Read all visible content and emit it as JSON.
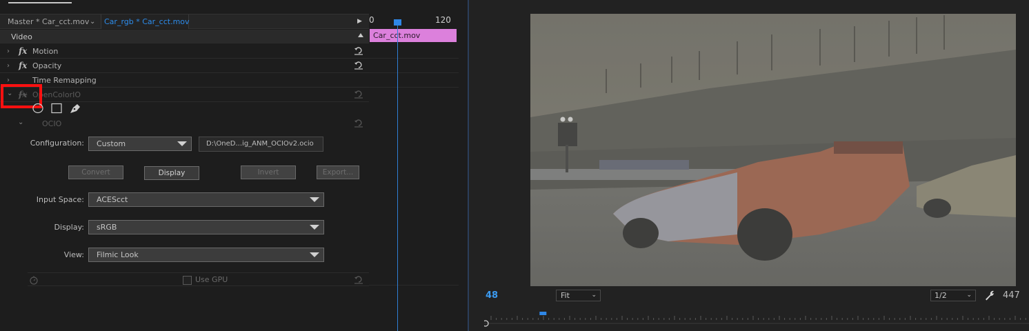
{
  "effect_controls": {
    "tabs": {
      "master": "Master * Car_cct.mov",
      "active": "Car_rgb * Car_cct.mov"
    },
    "section": "Video",
    "effects": [
      {
        "name": "Motion"
      },
      {
        "name": "Opacity"
      },
      {
        "name": "Time Remapping"
      },
      {
        "name": "OpenColorIO"
      }
    ],
    "ocio_group": "OCIO",
    "configuration": {
      "label": "Configuration:",
      "value": "Custom",
      "path": "D:\\OneD...ig_ANM_OCIOv2.ocio"
    },
    "buttons": {
      "convert": "Convert",
      "display": "Display",
      "invert": "Invert",
      "export": "Export..."
    },
    "input_space": {
      "label": "Input Space:",
      "value": "ACEScct"
    },
    "display": {
      "label": "Display:",
      "value": "sRGB"
    },
    "view": {
      "label": "View:",
      "value": "Filmic Look"
    },
    "use_gpu": {
      "label": "Use GPU",
      "checked": false
    }
  },
  "mini_timeline": {
    "start_label": "0",
    "end_label": "120",
    "clip_name": "Car_cct.mov"
  },
  "program_monitor": {
    "current_frame": "48",
    "zoom": "Fit",
    "resolution": "1/2",
    "duration_frame": "447",
    "playhead_fraction": 0.108
  },
  "colors": {
    "accent_blue": "#2d8ceb",
    "clip_pink": "#dc80dc",
    "highlight_red": "#ff1010"
  }
}
